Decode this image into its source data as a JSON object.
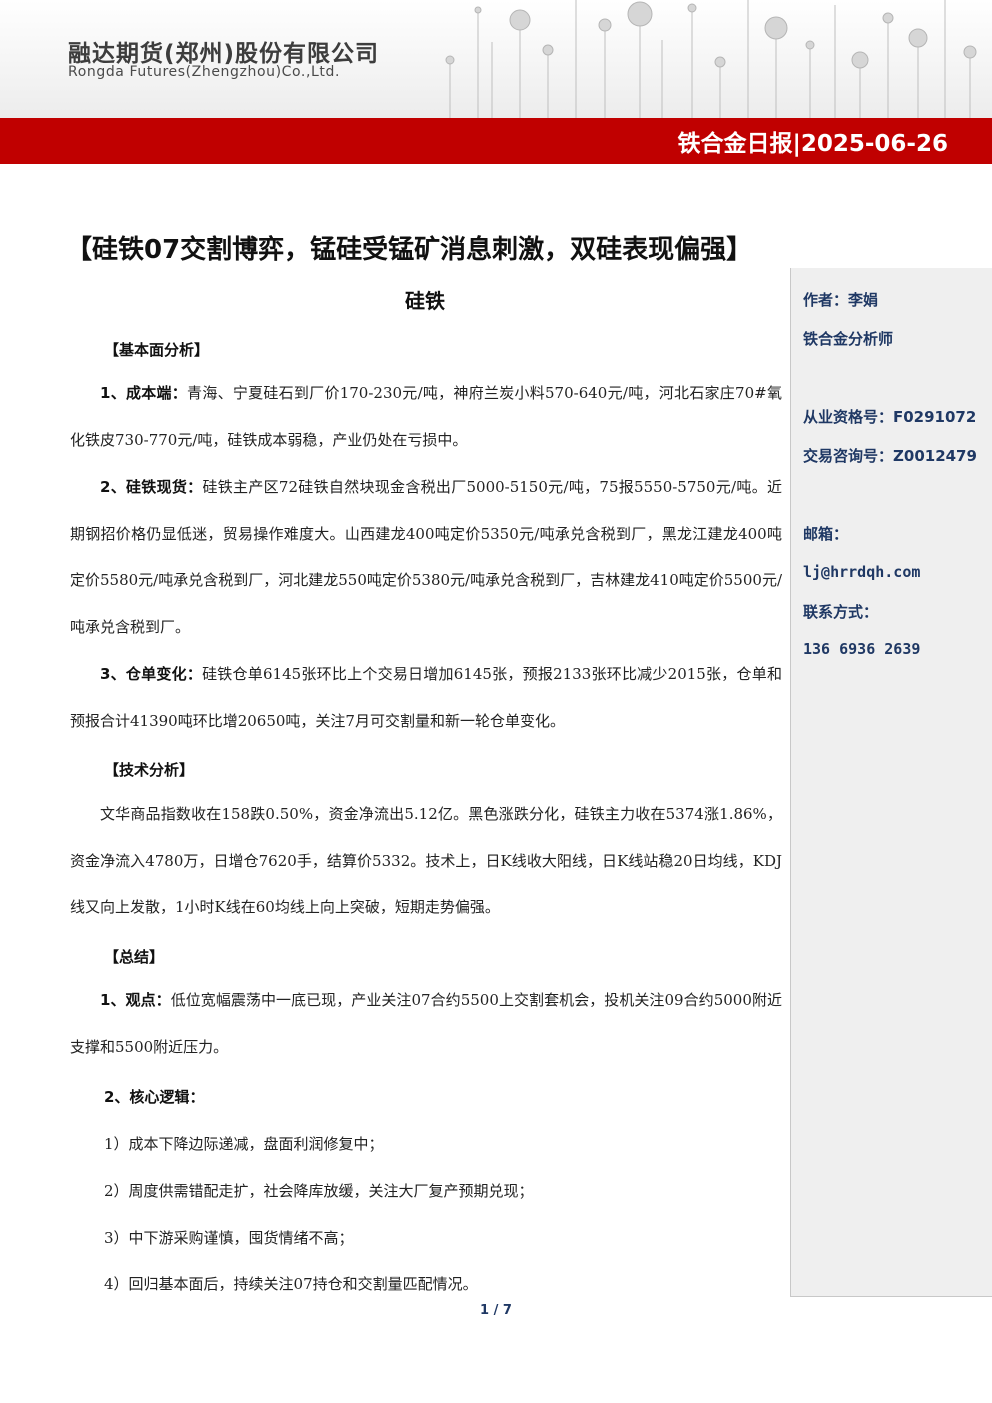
{
  "header": {
    "company_cn": "融达期货(郑州)股份有限公司",
    "company_en": "Rongda Futures(Zhengzhou)Co.,Ltd.",
    "report_title": "铁合金日报|2025-06-26"
  },
  "title": "【硅铁07交割博弈，锰硅受锰矿消息刺激，双硅表现偏强】",
  "section": "硅铁",
  "sidebar": {
    "author": "作者：李娟",
    "role": "铁合金分析师",
    "license": "从业资格号：F0291072",
    "consult": "交易咨询号：Z0012479",
    "email_label": "邮箱：",
    "email": "lj@hrrdqh.com",
    "contact_label": "联系方式：",
    "phone": "136 6936 2639"
  },
  "fundamental": {
    "heading": "【基本面分析】",
    "p1_label": "1、成本端：",
    "p1_text": "青海、宁夏硅石到厂价170-230元/吨，神府兰炭小料570-640元/吨，河北石家庄70#氧化铁皮730-770元/吨，硅铁成本弱稳，产业仍处在亏损中。",
    "p2_label": "2、硅铁现货：",
    "p2_text": "硅铁主产区72硅铁自然块现金含税出厂5000-5150元/吨，75报5550-5750元/吨。近期钢招价格仍显低迷，贸易操作难度大。山西建龙400吨定价5350元/吨承兑含税到厂，黑龙江建龙400吨定价5580元/吨承兑含税到厂，河北建龙550吨定价5380元/吨承兑含税到厂，吉林建龙410吨定价5500元/吨承兑含税到厂。",
    "p3_label": "3、仓单变化：",
    "p3_text": "硅铁仓单6145张环比上个交易日增加6145张，预报2133张环比减少2015张，仓单和预报合计41390吨环比增20650吨，关注7月可交割量和新一轮仓单变化。"
  },
  "technical": {
    "heading": "【技术分析】",
    "text": "文华商品指数收在158跌0.50%，资金净流出5.12亿。黑色涨跌分化，硅铁主力收在5374涨1.86%，资金净流入4780万，日增仓7620手，结算价5332。技术上，日K线收大阳线，日K线站稳20日均线，KDJ线又向上发散，1小时K线在60均线上向上突破，短期走势偏强。"
  },
  "summary": {
    "heading": "【总结】",
    "view_label": "1、观点：",
    "view_text": "低位宽幅震荡中一底已现，产业关注07合约5500上交割套机会，投机关注09合约5000附近支撑和5500附近压力。",
    "logic_label": "2、核心逻辑：",
    "items": [
      "1）成本下降边际递减，盘面利润修复中；",
      "2）周度供需错配走扩，社会降库放缓，关注大厂复产预期兑现；",
      "3）中下游采购谨慎，囤货情绪不高；",
      "4）回归基本面后，持续关注07持仓和交割量匹配情况。"
    ]
  },
  "page": "1 / 7",
  "colors": {
    "accent_red": "#c00000",
    "sidebar_bg": "#efefef",
    "sidebar_text": "#1f3864"
  }
}
